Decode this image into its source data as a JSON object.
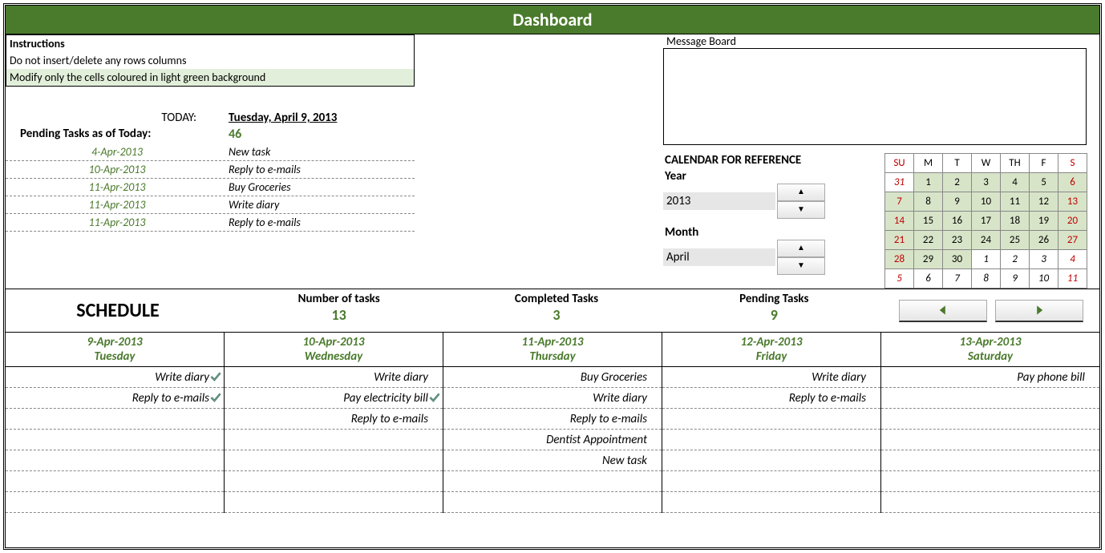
{
  "title": "Dashboard",
  "instructions": {
    "heading": "Instructions",
    "line1": "Do not insert/delete any rows columns",
    "line2": "Modify only the cells coloured in light green background"
  },
  "today_label": "TODAY:",
  "today_value": "Tuesday, April 9, 2013",
  "pending_label": "Pending Tasks as of Today:",
  "pending_count": "46",
  "pending_tasks": [
    {
      "date": "4-Apr-2013",
      "desc": "New task"
    },
    {
      "date": "10-Apr-2013",
      "desc": "Reply to e-mails"
    },
    {
      "date": "11-Apr-2013",
      "desc": "Buy Groceries"
    },
    {
      "date": "11-Apr-2013",
      "desc": "Write diary"
    },
    {
      "date": "11-Apr-2013",
      "desc": "Reply to e-mails"
    }
  ],
  "message_board_label": "Message Board",
  "calendar_title": "CALENDAR FOR REFERENCE",
  "year_label": "Year",
  "year_value": "2013",
  "month_label": "Month",
  "month_value": "April",
  "mini_cal": {
    "headers": [
      "SU",
      "M",
      "T",
      "W",
      "TH",
      "F",
      "S"
    ],
    "rows": [
      [
        {
          "v": "31",
          "cls": "red out"
        },
        {
          "v": "1",
          "cls": "greenbg"
        },
        {
          "v": "2",
          "cls": "greenbg"
        },
        {
          "v": "3",
          "cls": "greenbg"
        },
        {
          "v": "4",
          "cls": "greenbg"
        },
        {
          "v": "5",
          "cls": "greenbg"
        },
        {
          "v": "6",
          "cls": "red greenbg"
        }
      ],
      [
        {
          "v": "7",
          "cls": "red greenbg"
        },
        {
          "v": "8",
          "cls": "greenbg"
        },
        {
          "v": "9",
          "cls": "greenbg"
        },
        {
          "v": "10",
          "cls": "greenbg"
        },
        {
          "v": "11",
          "cls": "greenbg"
        },
        {
          "v": "12",
          "cls": "greenbg"
        },
        {
          "v": "13",
          "cls": "red greenbg"
        }
      ],
      [
        {
          "v": "14",
          "cls": "red greenbg"
        },
        {
          "v": "15",
          "cls": "greenbg"
        },
        {
          "v": "16",
          "cls": "greenbg"
        },
        {
          "v": "17",
          "cls": "greenbg"
        },
        {
          "v": "18",
          "cls": "greenbg"
        },
        {
          "v": "19",
          "cls": "greenbg"
        },
        {
          "v": "20",
          "cls": "red greenbg"
        }
      ],
      [
        {
          "v": "21",
          "cls": "red greenbg"
        },
        {
          "v": "22",
          "cls": "greenbg"
        },
        {
          "v": "23",
          "cls": "greenbg"
        },
        {
          "v": "24",
          "cls": "greenbg"
        },
        {
          "v": "25",
          "cls": "greenbg"
        },
        {
          "v": "26",
          "cls": "greenbg"
        },
        {
          "v": "27",
          "cls": "red greenbg"
        }
      ],
      [
        {
          "v": "28",
          "cls": "red greenbg"
        },
        {
          "v": "29",
          "cls": "greenbg"
        },
        {
          "v": "30",
          "cls": "greenbg"
        },
        {
          "v": "1",
          "cls": "out"
        },
        {
          "v": "2",
          "cls": "out"
        },
        {
          "v": "3",
          "cls": "out"
        },
        {
          "v": "4",
          "cls": "red out"
        }
      ],
      [
        {
          "v": "5",
          "cls": "red out"
        },
        {
          "v": "6",
          "cls": "out"
        },
        {
          "v": "7",
          "cls": "out"
        },
        {
          "v": "8",
          "cls": "out"
        },
        {
          "v": "9",
          "cls": "out"
        },
        {
          "v": "10",
          "cls": "out"
        },
        {
          "v": "11",
          "cls": "red out"
        }
      ]
    ]
  },
  "schedule_title": "SCHEDULE",
  "summary": [
    {
      "label": "Number of tasks",
      "value": "13"
    },
    {
      "label": "Completed Tasks",
      "value": "3"
    },
    {
      "label": "Pending Tasks",
      "value": "9"
    }
  ],
  "days": [
    {
      "date": "9-Apr-2013",
      "name": "Tuesday",
      "tasks": [
        {
          "t": "Write diary",
          "done": true
        },
        {
          "t": "Reply to e-mails",
          "done": true
        }
      ]
    },
    {
      "date": "10-Apr-2013",
      "name": "Wednesday",
      "tasks": [
        {
          "t": "Write diary",
          "done": false
        },
        {
          "t": "Pay electricity bill",
          "done": true
        },
        {
          "t": "Reply to e-mails",
          "done": false
        }
      ]
    },
    {
      "date": "11-Apr-2013",
      "name": "Thursday",
      "tasks": [
        {
          "t": "Buy Groceries",
          "done": false
        },
        {
          "t": "Write diary",
          "done": false
        },
        {
          "t": "Reply to e-mails",
          "done": false
        },
        {
          "t": "Dentist Appointment",
          "done": false
        },
        {
          "t": "New task",
          "done": false
        }
      ]
    },
    {
      "date": "12-Apr-2013",
      "name": "Friday",
      "tasks": [
        {
          "t": "Write diary",
          "done": false
        },
        {
          "t": "Reply to e-mails",
          "done": false
        }
      ]
    },
    {
      "date": "13-Apr-2013",
      "name": "Saturday",
      "tasks": [
        {
          "t": "Pay phone bill",
          "done": false
        }
      ]
    }
  ],
  "slot_count": 7
}
